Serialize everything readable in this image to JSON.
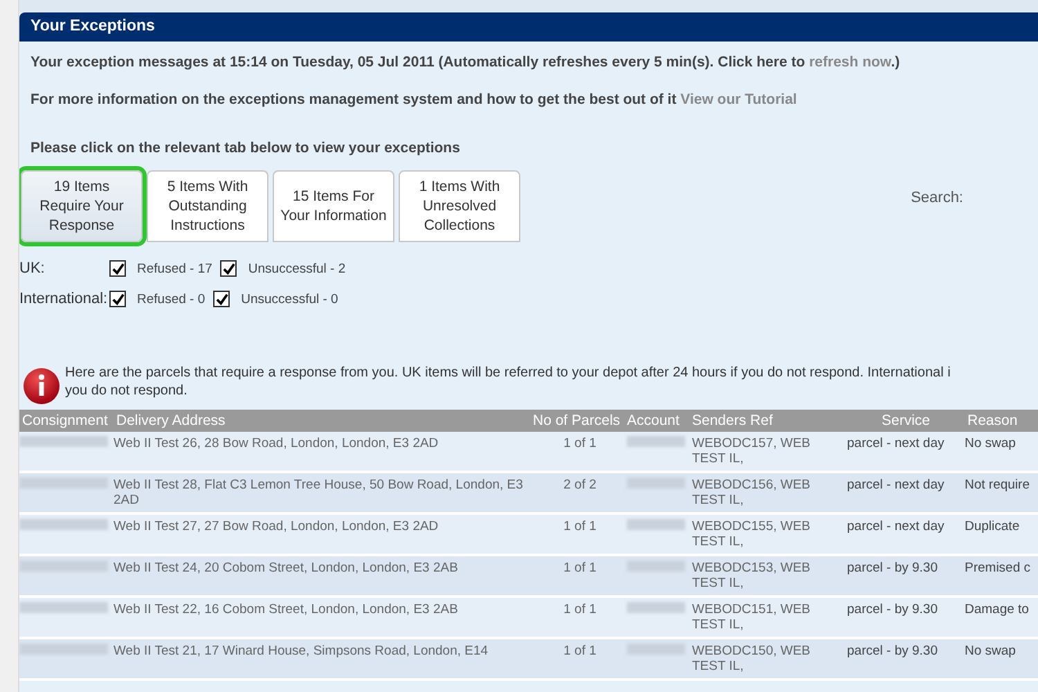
{
  "panel": {
    "title": "Your Exceptions"
  },
  "intro": {
    "text": "Your exception messages at 15:14 on Tuesday, 05 Jul 2011 (Automatically refreshes every 5 min(s). Click here to",
    "link": "refresh now",
    "after": ".)"
  },
  "tutorial": {
    "text": "For more information on the exceptions management system and how to get the best out of it",
    "link": "View our Tutorial"
  },
  "instruction": "Please click on the relevant tab below to view your exceptions",
  "tabs": [
    {
      "label": "19 Items Require Your Response",
      "selected": true
    },
    {
      "label": "5 Items With Outstanding Instructions",
      "selected": false
    },
    {
      "label": "15 Items For Your Information",
      "selected": false
    },
    {
      "label": "1 Items With Unresolved Collections",
      "selected": false
    }
  ],
  "search": {
    "label": "Search:"
  },
  "filters": [
    {
      "region": "UK:",
      "options": [
        {
          "label": "Refused - 17",
          "checked": true
        },
        {
          "label": "Unsuccessful - 2",
          "checked": true
        }
      ]
    },
    {
      "region": "International:",
      "options": [
        {
          "label": "Refused - 0",
          "checked": true
        },
        {
          "label": "Unsuccessful - 0",
          "checked": true
        }
      ]
    }
  ],
  "notice": {
    "lines": [
      "Here are the parcels that require a response from you. UK items will be referred to your depot after 24 hours if you do not respond. International i",
      "you do not respond."
    ]
  },
  "table": {
    "columns": [
      "Consignment",
      "Delivery Address",
      "No of Parcels",
      "Account",
      "Senders Ref",
      "Service",
      "Reason"
    ],
    "rows": [
      {
        "address": "Web II Test 26, 28 Bow Road, London, London, E3 2AD",
        "parcels": "1 of 1",
        "senders_ref": "WEBODC157, WEB TEST IL,",
        "service": "parcel - next day",
        "reason": "No swap"
      },
      {
        "address": "Web II Test 28, Flat C3 Lemon Tree House, 50 Bow Road, London, E3 2AD",
        "parcels": "2 of 2",
        "senders_ref": "WEBODC156, WEB TEST IL,",
        "service": "parcel - next day",
        "reason": "Not require"
      },
      {
        "address": "Web II Test 27, 27 Bow Road, London, London, E3 2AD",
        "parcels": "1 of 1",
        "senders_ref": "WEBODC155, WEB TEST IL,",
        "service": "parcel - next day",
        "reason": "Duplicate"
      },
      {
        "address": "Web II Test 24, 20 Cobom Street, London, London, E3 2AB",
        "parcels": "1 of 1",
        "senders_ref": "WEBODC153, WEB TEST IL,",
        "service": "parcel - by 9.30",
        "reason": "Premised c"
      },
      {
        "address": "Web II Test 22, 16 Cobom Street, London, London, E3 2AB",
        "parcels": "1 of 1",
        "senders_ref": "WEBODC151, WEB TEST IL,",
        "service": "parcel - by 9.30",
        "reason": "Damage to"
      },
      {
        "address": "Web II Test 21, 17 Winard House, Simpsons Road, London, E14",
        "parcels": "1 of 1",
        "senders_ref": "WEBODC150, WEB TEST IL,",
        "service": "parcel - by 9.30",
        "reason": "No swap"
      }
    ]
  }
}
